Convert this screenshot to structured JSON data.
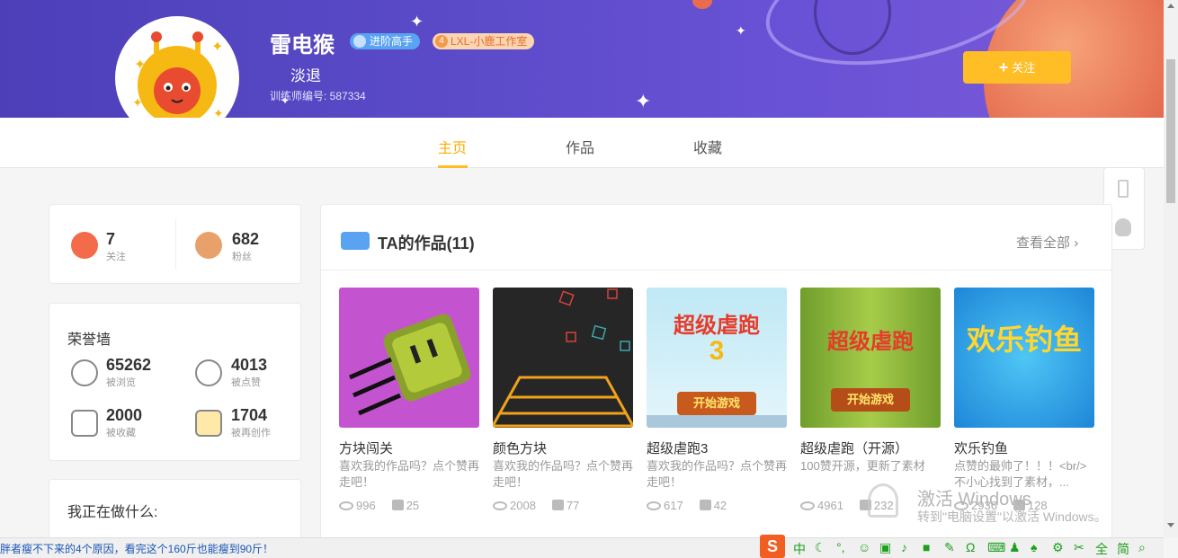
{
  "profile": {
    "name": "雷电猴",
    "badge_level": "进阶高手",
    "badge_studio": "LXL-小鹿工作室",
    "badge_studio_num": "4",
    "signature": "淡退",
    "trainer_id": "训练师编号: 587334",
    "follow_label": "关注"
  },
  "tabs": [
    {
      "label": "主页",
      "active": true
    },
    {
      "label": "作品",
      "active": false
    },
    {
      "label": "收藏",
      "active": false
    }
  ],
  "social": {
    "following": {
      "value": "7",
      "label": "关注"
    },
    "fans": {
      "value": "682",
      "label": "粉丝"
    }
  },
  "honor": {
    "title": "荣誉墙",
    "views": {
      "value": "65262",
      "label": "被浏览"
    },
    "likes": {
      "value": "4013",
      "label": "被点赞"
    },
    "collects": {
      "value": "2000",
      "label": "被收藏"
    },
    "remixes": {
      "value": "1704",
      "label": "被再创作"
    }
  },
  "doing": {
    "title": "我正在做什么:"
  },
  "works": {
    "title": "TA的作品(11)",
    "view_all": "查看全部",
    "items": [
      {
        "title": "方块闯关",
        "desc": "喜欢我的作品吗？点个赞再走吧！",
        "views": "996",
        "likes": "25"
      },
      {
        "title": "颜色方块",
        "desc": "喜欢我的作品吗？点个赞再走吧！",
        "views": "2008",
        "likes": "77"
      },
      {
        "title": "超级虐跑3",
        "desc": "喜欢我的作品吗？点个赞再走吧！",
        "views": "617",
        "likes": "42"
      },
      {
        "title": "超级虐跑（开源）",
        "desc": "100赞开源，更新了素材",
        "views": "4961",
        "likes": "232"
      },
      {
        "title": "欢乐钓鱼",
        "desc": "点赞的最帅了！！！<br/>不小心找到了素材，...",
        "views": "2936",
        "likes": "128"
      }
    ],
    "thumb_text": {
      "game3": "超级虐跑",
      "game3_num": "3",
      "start": "开始游戏",
      "game5": "欢乐钓鱼"
    }
  },
  "statusbar": {
    "text": "胖者瘦不下来的4个原因，看完这个160斤也能瘦到90斤！",
    "ime_items": [
      "中",
      "全",
      "简"
    ]
  },
  "watermark": {
    "title": "激活 Windows",
    "subtitle": "转到\"电脑设置\"以激活 Windows。"
  },
  "colors": {
    "accent": "#ffbe26",
    "banner": "#5b4bc9",
    "link": "#1a56b8"
  }
}
